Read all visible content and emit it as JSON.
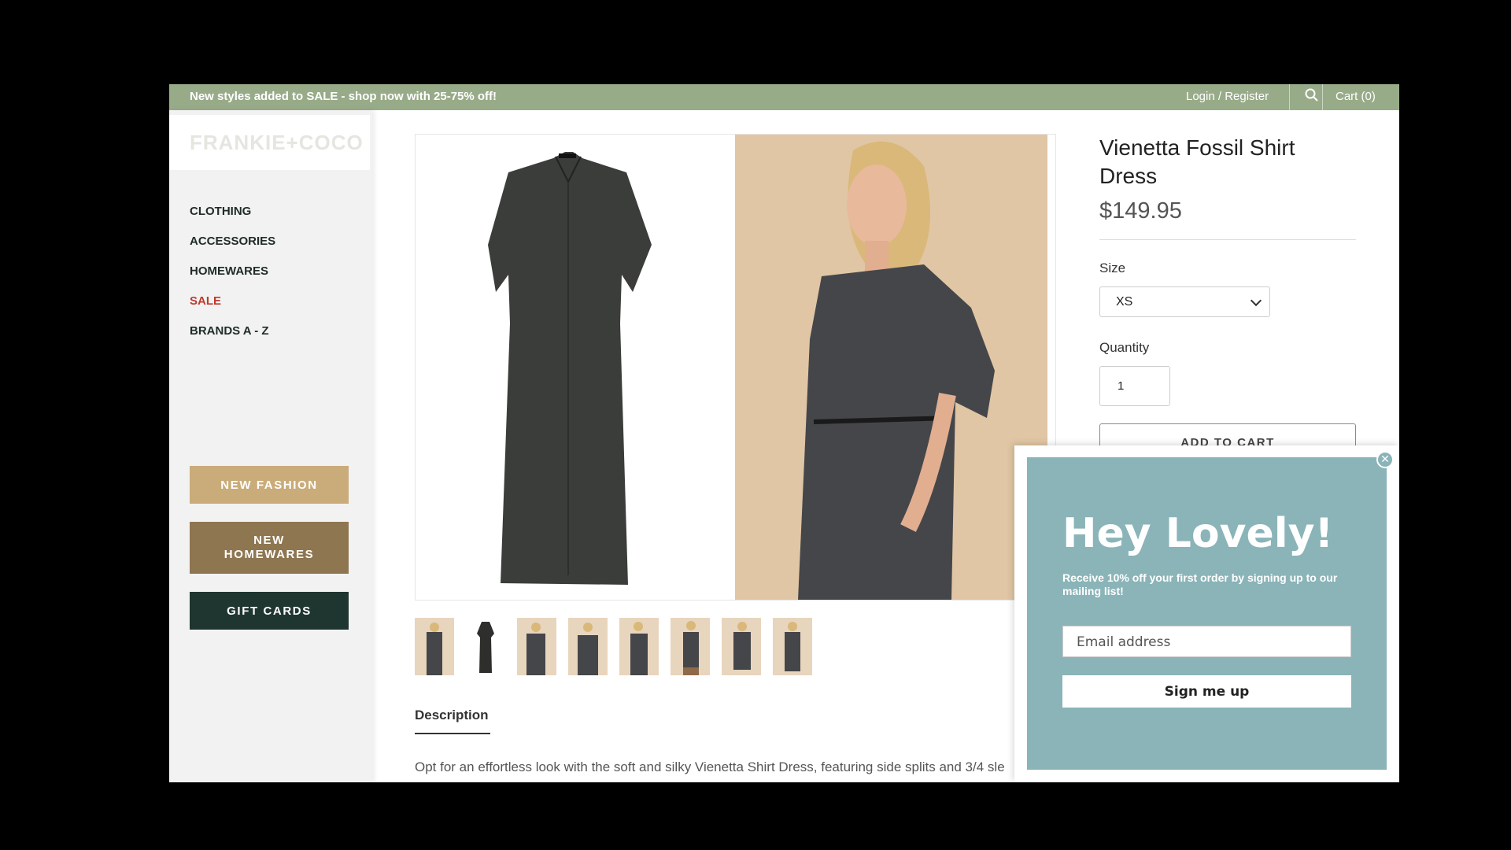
{
  "topbar": {
    "promo": "New styles added to SALE - shop now with 25-75% off!",
    "login": "Login / Register",
    "cart": "Cart (0)",
    "bg_color": "#98ab89"
  },
  "sidebar": {
    "logo": "FRANKIE+COCO",
    "nav": [
      "CLOTHING",
      "ACCESSORIES",
      "HOMEWARES",
      "SALE",
      "BRANDS A - Z"
    ],
    "buttons": {
      "new_fashion": "NEW FASHION",
      "new_homewares": "NEW HOMEWARES",
      "gift_cards": "GIFT CARDS"
    },
    "sale_color": "#c0392b"
  },
  "product": {
    "title": "Vienetta Fossil Shirt Dress",
    "price": "$149.95",
    "size_label": "Size",
    "size_value": "XS",
    "quantity_label": "Quantity",
    "quantity_value": "1",
    "add_to_cart": "ADD TO CART"
  },
  "description": {
    "tab": "Description",
    "text": "Opt for an effortless look with the soft and silky Vienetta Shirt Dress, featuring side splits and 3/4 sle"
  },
  "popup": {
    "heading": "Hey Lovely!",
    "body": "Receive 10% off your first order by signing up to our mailing list!",
    "email_placeholder": "Email address",
    "button": "Sign me up",
    "bg_color": "#8ab4b8"
  }
}
